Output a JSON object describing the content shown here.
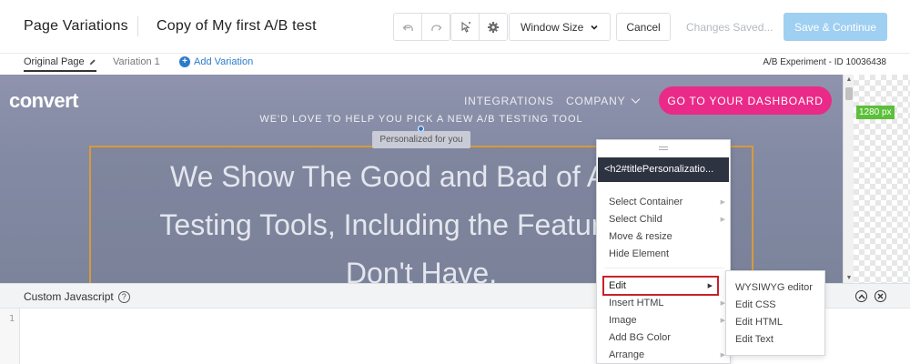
{
  "toolbar": {
    "app_title": "Page Variations",
    "doc_title": "Copy of My first A/B test",
    "window_size_label": "Window Size",
    "cancel_label": "Cancel",
    "status_text": "Changes Saved...",
    "save_continue_label": "Save & Continue"
  },
  "tabs": {
    "original": "Original Page",
    "variation": "Variation 1",
    "add": "Add Variation",
    "experiment_id": "A/B Experiment - ID 10036438"
  },
  "preview": {
    "logo": "convert",
    "nav": [
      "INTEGRATIONS",
      "COMPANY"
    ],
    "cta": "GO TO YOUR DASHBOARD",
    "tagline": "WE'D LOVE TO HELP YOU PICK A NEW A/B TESTING TOOL",
    "personalized_label": "Personalized for you",
    "headline_lines": [
      "We Show The Good and Bad of All A/B",
      "Testing Tools, Including the Features We",
      "Don't Have."
    ],
    "viewport_width": "1280 px"
  },
  "code_panel": {
    "title": "Custom Javascript",
    "help_symbol": "?",
    "line_number": "1"
  },
  "context_menu": {
    "selector": "<h2#titlePersonalizatio...",
    "items": [
      {
        "label": "Select Container",
        "submenu": true
      },
      {
        "label": "Select Child",
        "submenu": true
      },
      {
        "label": "Move & resize",
        "submenu": false
      },
      {
        "label": "Hide Element",
        "submenu": false
      },
      {
        "label": "Edit",
        "submenu": true
      },
      {
        "label": "Insert HTML",
        "submenu": true
      },
      {
        "label": "Image",
        "submenu": true
      },
      {
        "label": "Add BG Color",
        "submenu": false
      },
      {
        "label": "Arrange",
        "submenu": true
      }
    ],
    "submenu_items": [
      "WYSIWYG editor",
      "Edit CSS",
      "Edit HTML",
      "Edit Text"
    ]
  },
  "colors": {
    "accent_blue": "#2b7bcb",
    "cta_pink": "#ea2a88",
    "save_button": "#9fcff1",
    "highlight_red": "#c7222a",
    "selection_orange": "#d69a3c"
  }
}
